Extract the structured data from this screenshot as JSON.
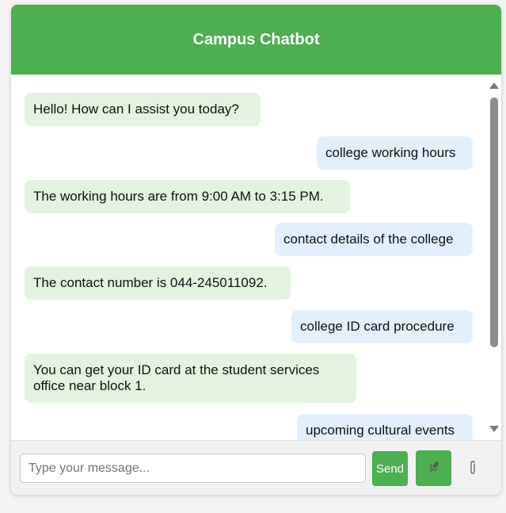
{
  "header": {
    "title": "Campus Chatbot"
  },
  "messages": [
    {
      "sender": "bot",
      "text": "Hello! How can I assist you today?"
    },
    {
      "sender": "user",
      "text": "college working hours"
    },
    {
      "sender": "bot",
      "text": "The working hours are from 9:00 AM to 3:15 PM."
    },
    {
      "sender": "user",
      "text": "contact details of the college"
    },
    {
      "sender": "bot",
      "text": "The contact number is 044-245011092."
    },
    {
      "sender": "user",
      "text": "college ID card procedure"
    },
    {
      "sender": "bot",
      "text": "You can get your ID card at the student services office near block 1."
    },
    {
      "sender": "user",
      "text": "upcoming cultural events"
    }
  ],
  "input": {
    "placeholder": "Type your message...",
    "value": ""
  },
  "buttons": {
    "send_label": "Send",
    "mic_icon": "microphone-icon",
    "attach_icon": "paperclip-icon"
  },
  "colors": {
    "accent": "#4caf50",
    "bot_bubble": "#e3f3df",
    "user_bubble": "#e3f0fb"
  }
}
